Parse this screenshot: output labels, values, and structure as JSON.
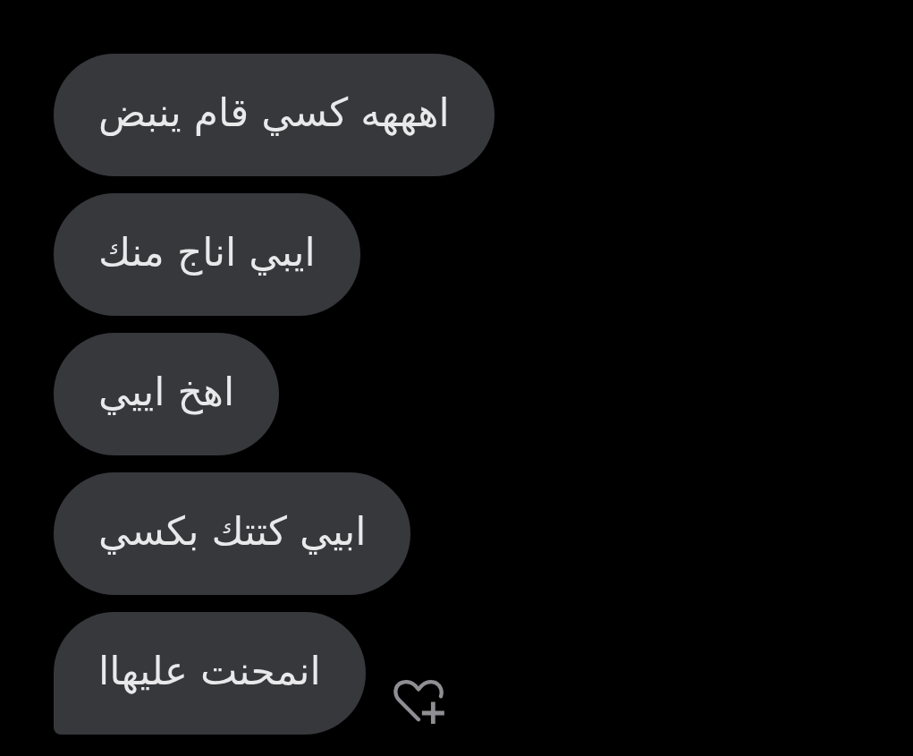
{
  "messages": [
    {
      "text": "اهههه كسي قام ينبض"
    },
    {
      "text": "ايبي اناج منك"
    },
    {
      "text": "اهخ اييي"
    },
    {
      "text": "ابيي كتتك بكسي"
    },
    {
      "text": "انمحنت عليهاا"
    }
  ]
}
